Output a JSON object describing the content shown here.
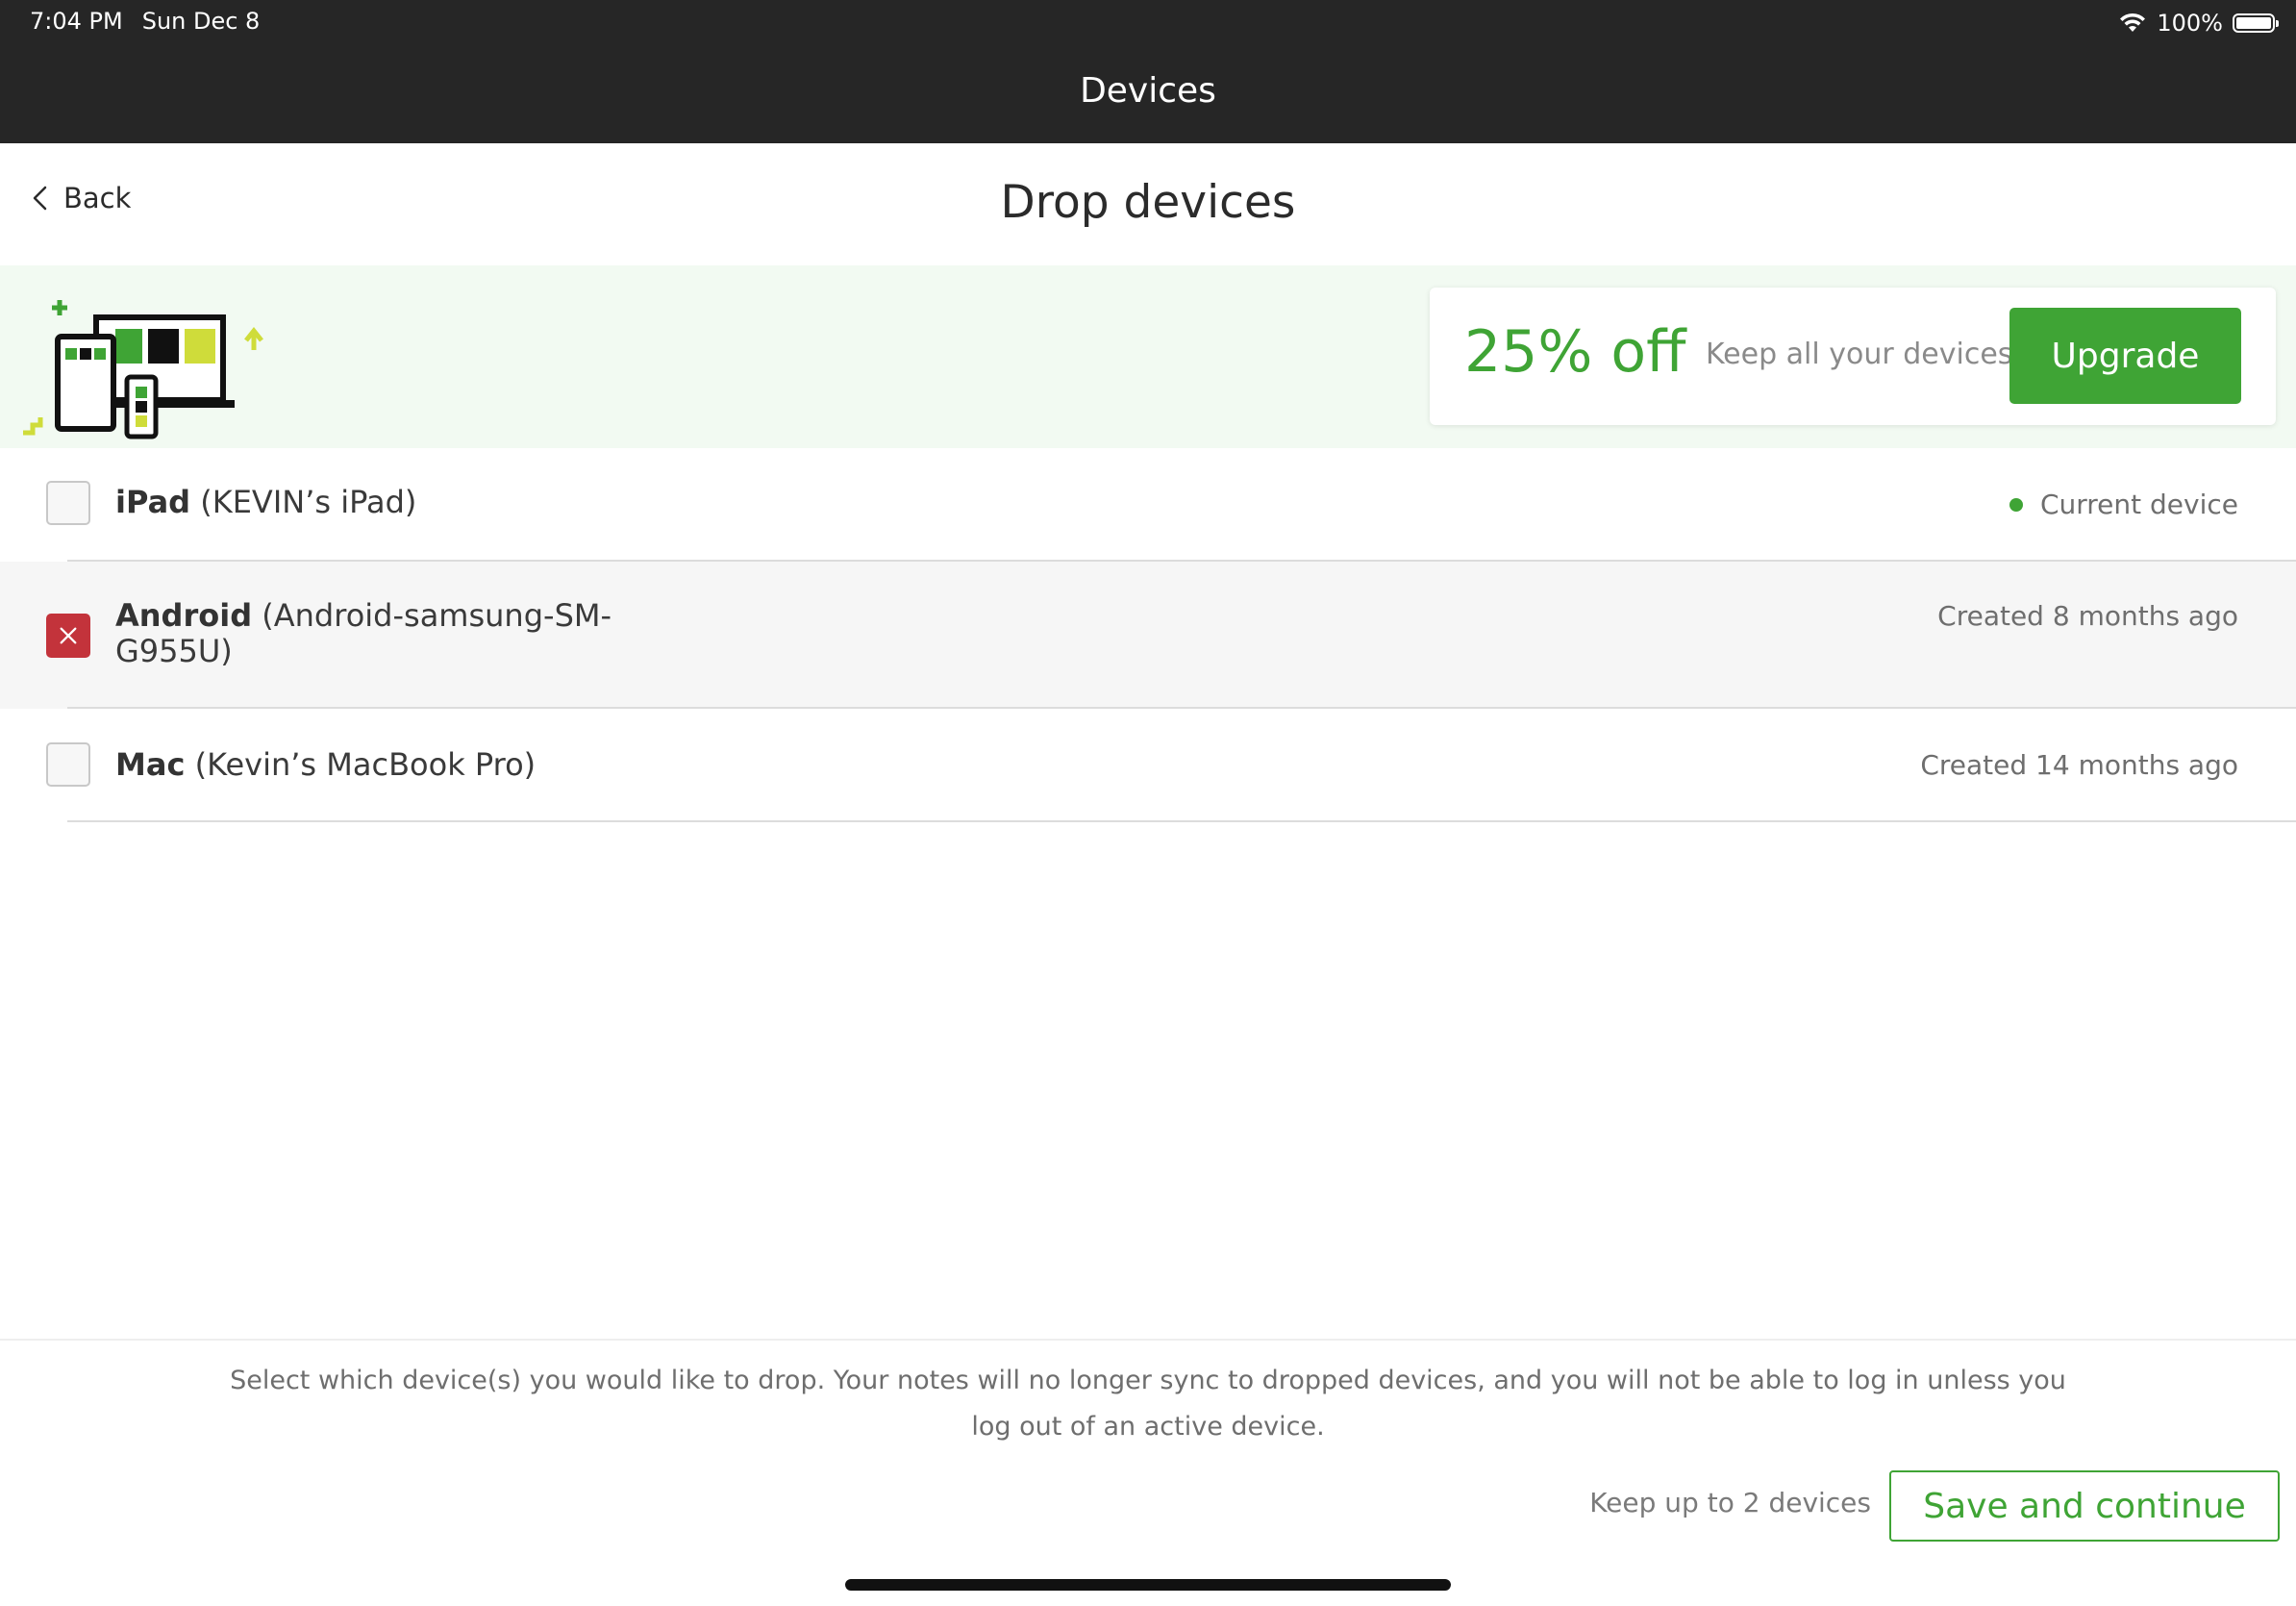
{
  "status_bar": {
    "time": "7:04 PM",
    "date": "Sun Dec 8",
    "battery": "100%"
  },
  "app": {
    "title": "Devices"
  },
  "header": {
    "back_label": "Back",
    "title": "Drop devices"
  },
  "promo": {
    "discount": "25% off",
    "text": "Keep all your devices",
    "upgrade_label": "Upgrade"
  },
  "devices": [
    {
      "type": "iPad",
      "name": "(KEVIN’s iPad)",
      "meta": "Current device",
      "is_current": true,
      "selected": false
    },
    {
      "type": "Android",
      "name": "(Android-samsung-SM-G955U)",
      "meta": "Created 8 months ago",
      "is_current": false,
      "selected": true
    },
    {
      "type": "Mac",
      "name": "(Kevin’s MacBook Pro)",
      "meta": "Created 14 months ago",
      "is_current": false,
      "selected": false
    }
  ],
  "footer": {
    "info": "Select which device(s) you would like to drop. Your notes will no longer sync to dropped devices, and you will not be able to log in unless you log out of an active device.",
    "limit": "Keep up to 2 devices",
    "save_label": "Save and continue"
  },
  "colors": {
    "brand_green": "#3fa435",
    "drop_red": "#c3333b",
    "topbar": "#262626",
    "promo_bg": "#f2faf2"
  }
}
